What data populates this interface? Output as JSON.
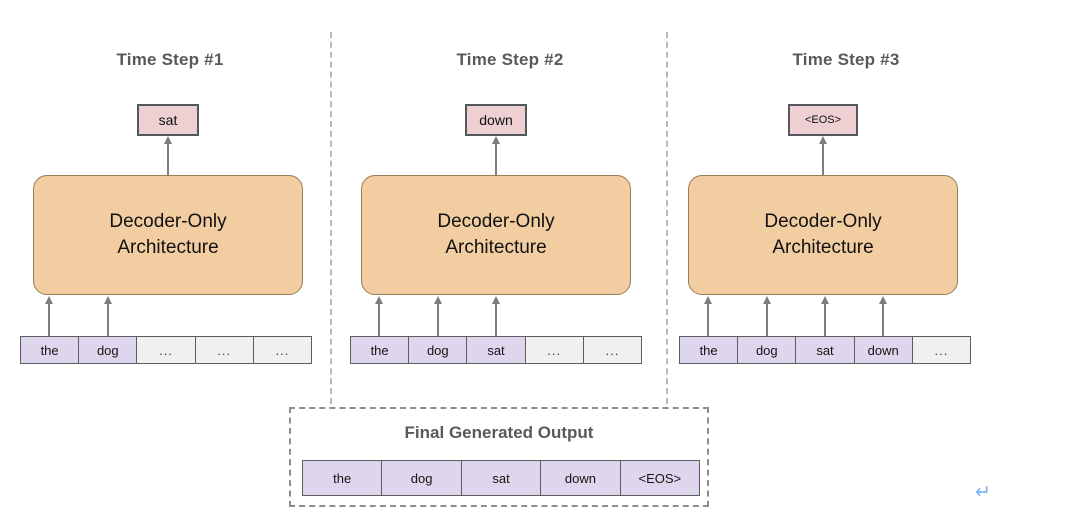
{
  "figure": {
    "corner_mark": "◥",
    "return_glyph": "↵"
  },
  "colors": {
    "prediction_box_fill": "#eed0d3",
    "decoder_fill": "#f2cda2",
    "decoder_border": "#9a7b56",
    "token_filled_fill": "#ddd6ec",
    "token_empty_fill": "#f0f0f0",
    "box_border": "#55585c",
    "title_text": "#595959",
    "divider": "#b9b9b9",
    "return_glyph": "#7aaef5"
  },
  "steps": [
    {
      "title": "Time Step #1",
      "prediction": "sat",
      "decoder_label": "Decoder-Only\nArchitecture",
      "tokens": [
        {
          "text": "the",
          "filled": true
        },
        {
          "text": "dog",
          "filled": true
        },
        {
          "text": "...",
          "filled": false
        },
        {
          "text": "...",
          "filled": false
        },
        {
          "text": "...",
          "filled": false
        }
      ],
      "input_arrow_count": 2
    },
    {
      "title": "Time Step #2",
      "prediction": "down",
      "decoder_label": "Decoder-Only\nArchitecture",
      "tokens": [
        {
          "text": "the",
          "filled": true
        },
        {
          "text": "dog",
          "filled": true
        },
        {
          "text": "sat",
          "filled": true
        },
        {
          "text": "...",
          "filled": false
        },
        {
          "text": "...",
          "filled": false
        }
      ],
      "input_arrow_count": 3
    },
    {
      "title": "Time Step #3",
      "prediction": "<EOS>",
      "decoder_label": "Decoder-Only\nArchitecture",
      "tokens": [
        {
          "text": "the",
          "filled": true
        },
        {
          "text": "dog",
          "filled": true
        },
        {
          "text": "sat",
          "filled": true
        },
        {
          "text": "down",
          "filled": true
        },
        {
          "text": "...",
          "filled": false
        }
      ],
      "input_arrow_count": 4
    }
  ],
  "final_output": {
    "title": "Final Generated Output",
    "tokens": [
      "the",
      "dog",
      "sat",
      "down",
      "<EOS>"
    ]
  }
}
